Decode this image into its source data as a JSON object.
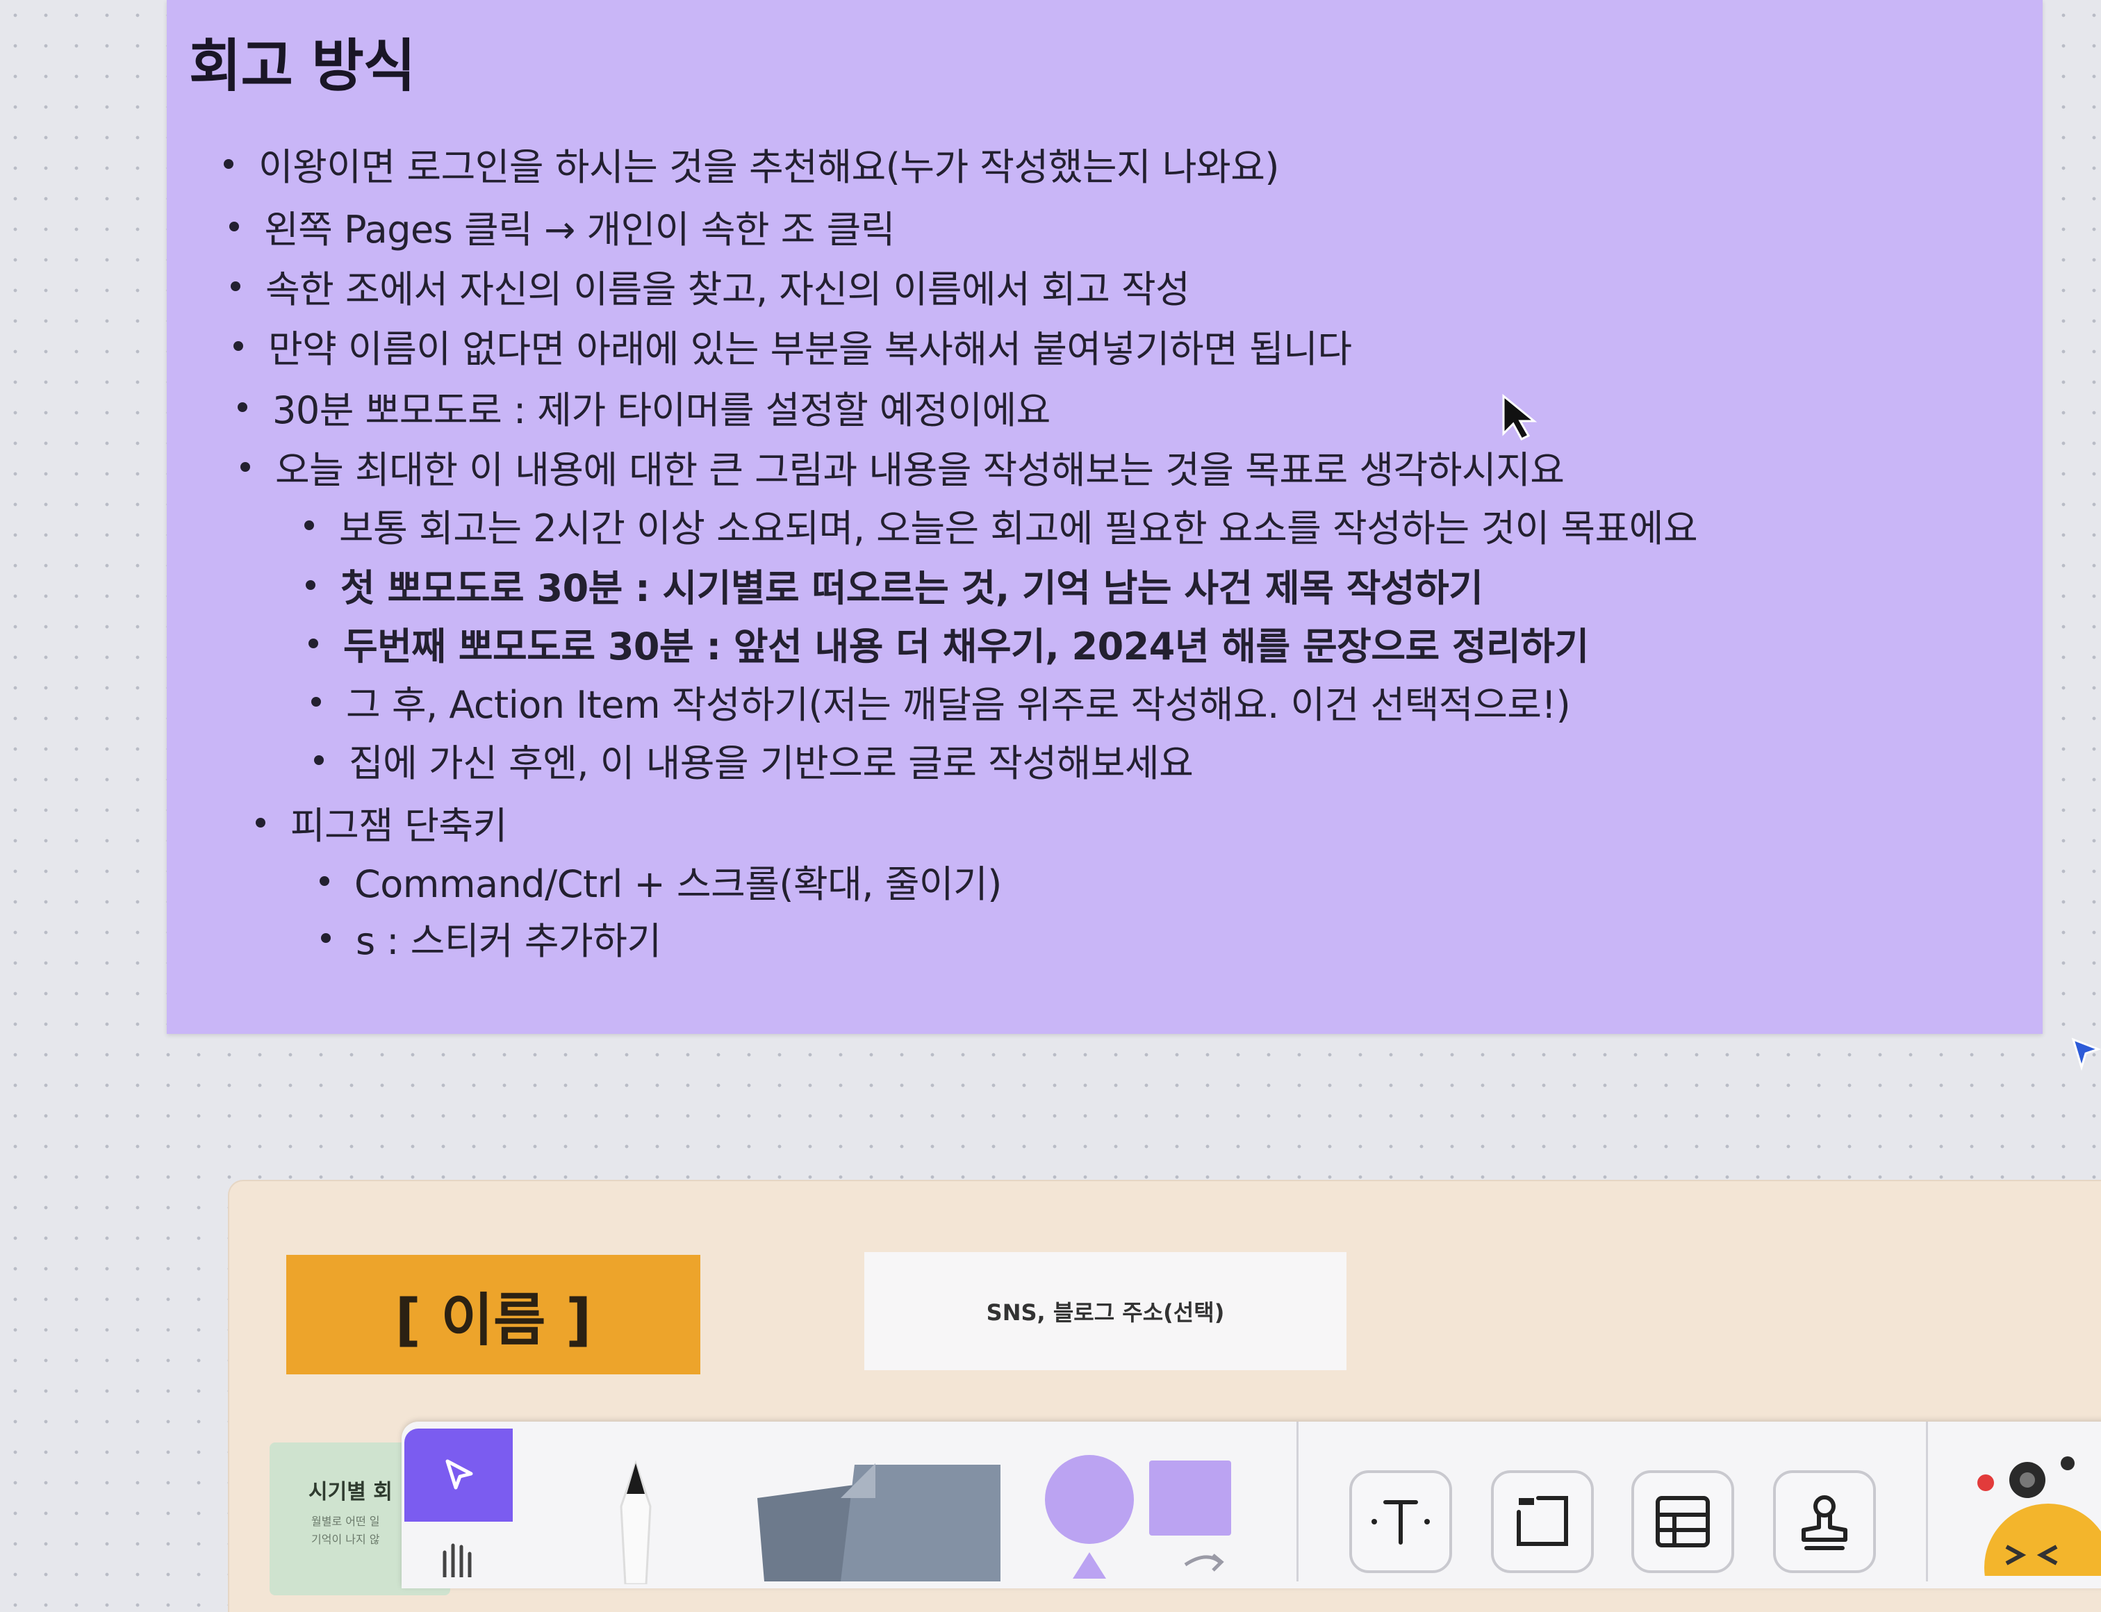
{
  "section": {
    "heading": "회고 방식",
    "bullets": [
      "이왕이면 로그인을 하시는 것을 추천해요(누가 작성했는지 나와요)",
      "왼쪽 Pages 클릭 → 개인이 속한 조 클릭",
      "속한 조에서 자신의 이름을 찾고, 자신의 이름에서 회고 작성",
      "만약 이름이 없다면 아래에 있는 부분을 복사해서 붙여넣기하면 됩니다",
      "30분 뽀모도로 : 제가 타이머를 설정할 예정이에요",
      "오늘 최대한 이 내용에 대한 큰 그림과 내용을 작성해보는 것을 목표로 생각하시지요"
    ],
    "sub_bullets": [
      "보통 회고는 2시간 이상 소요되며, 오늘은 회고에 필요한 요소를 작성하는 것이 목표에요",
      "첫 뽀모도로 30분 : 시기별로 떠오르는 것, 기억 남는 사건 제목 작성하기",
      "두번째 뽀모도로 30분 : 앞선 내용 더 채우기, 2024년 해를 문장으로 정리하기",
      "그 후, Action Item 작성하기(저는 깨달음 위주로 작성해요. 이건 선택적으로!)",
      "집에 가신 후엔, 이 내용을 기반으로 글로 작성해보세요"
    ],
    "shortcut_title": "피그잼 단축키",
    "shortcuts": [
      "Command/Ctrl + 스크롤(확대, 줄이기)",
      "s : 스티커 추가하기"
    ]
  },
  "template": {
    "name_label": "[ 이름 ]",
    "sns_label": "SNS, 블로그 주소(선택)",
    "timeline_title": "시기별 회",
    "timeline_sub1": "월별로 어떤 일",
    "timeline_sub2": "기억이 나지 않"
  },
  "toolbar": {
    "text_tool_icon": "text-icon",
    "section_tool_icon": "section-icon",
    "table_tool_icon": "table-icon",
    "stamp_tool_icon": "stamp-icon"
  },
  "colors": {
    "purple_card": "#c9b6f7",
    "name_box": "#eda42b",
    "accent": "#7b5cf0",
    "peach_card": "#f3e5d5"
  }
}
